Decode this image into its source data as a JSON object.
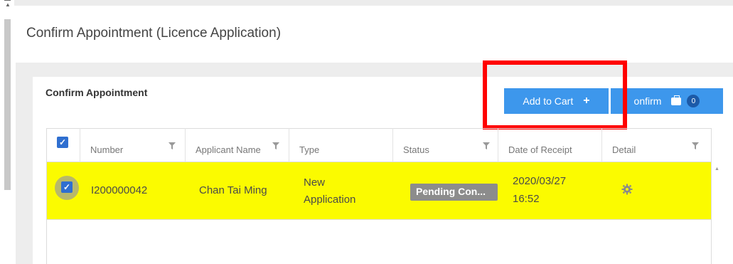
{
  "page": {
    "title": "Confirm Appointment (Licence Application)"
  },
  "card": {
    "title": "Confirm Appointment"
  },
  "toolbar": {
    "add_to_cart_label": "Add to Cart",
    "confirm_label": "onfirm",
    "confirm_count": "0"
  },
  "table": {
    "columns": [
      "Number",
      "Applicant Name",
      "Type",
      "Status",
      "Date of Receipt",
      "Detail"
    ],
    "rows": [
      {
        "number": "I200000042",
        "applicant_name": "Chan Tai Ming",
        "type_line1": "New",
        "type_line2": "Application",
        "status": "Pending Con...",
        "date_line1": "2020/03/27",
        "date_line2": "16:52",
        "detail_icon": "gear-icon",
        "selected": true
      }
    ]
  },
  "colors": {
    "primary": "#3d97ec",
    "row_highlight": "#fbfb00",
    "annotation": "#ff0000",
    "status_pill": "#8c8c8c"
  }
}
